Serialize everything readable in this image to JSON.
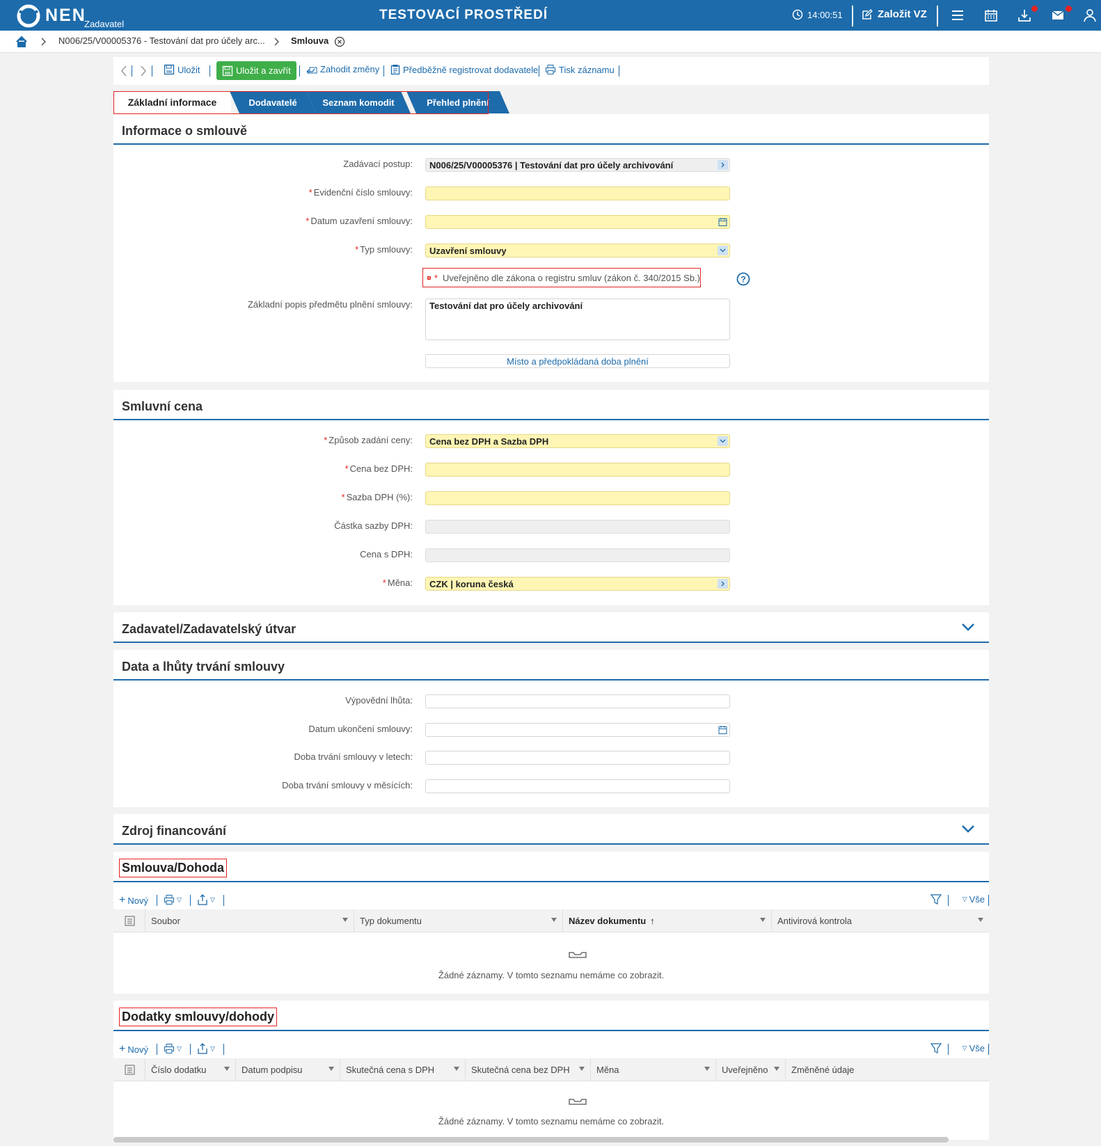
{
  "topbar": {
    "logo": "NEN",
    "logo_sub": "Zadavatel",
    "env_title": "TESTOVACÍ PROSTŘEDÍ",
    "time": "14:00:51",
    "new_tender": "Založit VZ",
    "icons": [
      "menu-icon",
      "calendar-icon",
      "download-icon",
      "mail-icon",
      "user-icon"
    ]
  },
  "breadcrumb": {
    "item1": "N006/25/V00005376 - Testování dat pro účely arc...",
    "item2": "Smlouva"
  },
  "toolbar": {
    "save": "Uložit",
    "save_close": "Uložit a zavřít",
    "discard": "Zahodit změny",
    "preregister": "Předběžně registrovat dodavatele",
    "print": "Tisk záznamu"
  },
  "tabs": [
    "Základní informace",
    "Dodavatelé",
    "Seznam komodit",
    "Přehled plnění"
  ],
  "contract_info": {
    "title": "Informace o smlouvě",
    "procedure_label": "Zadávací postup:",
    "procedure_value": "N006/25/V00005376 | Testování dat pro účely archivování",
    "number_label": "Evidenční číslo smlouvy:",
    "number_value": "",
    "date_label": "Datum uzavření smlouvy:",
    "date_value": "",
    "type_label": "Typ smlouvy:",
    "type_value": "Uzavření smlouvy",
    "published_label": "Uveřejněno dle zákona o registru smluv (zákon č. 340/2015 Sb.)",
    "description_label": "Základní popis předmětu plnění smlouvy:",
    "description_value": "Testování dat pro účely archivování",
    "place_button": "Místo a předpokládaná doba plnění"
  },
  "price": {
    "title": "Smluvní cena",
    "method_label": "Způsob zadání ceny:",
    "method_value": "Cena bez DPH a Sazba DPH",
    "net_label": "Cena bez DPH:",
    "vat_rate_label": "Sazba DPH (%):",
    "vat_amount_label": "Částka sazby DPH:",
    "gross_label": "Cena s DPH:",
    "currency_label": "Měna:",
    "currency_value": "CZK | koruna česká"
  },
  "authority": {
    "title": "Zadavatel/Zadavatelský útvar"
  },
  "dates": {
    "title": "Data a lhůty trvání smlouvy",
    "notice_label": "Výpovědní lhůta:",
    "end_label": "Datum ukončení smlouvy:",
    "years_label": "Doba trvání smlouvy v letech:",
    "months_label": "Doba trvání smlouvy v měsících:"
  },
  "funding": {
    "title": "Zdroj financování"
  },
  "contract_docs": {
    "title": "Smlouva/Dohoda",
    "new": "Nový",
    "all": "Vše",
    "columns": [
      "Soubor",
      "Typ dokumentu",
      "Název dokumentu",
      "Antivirová kontrola"
    ],
    "empty": "Žádné záznamy. V tomto seznamu nemáme co zobrazit."
  },
  "amendments": {
    "title": "Dodatky smlouvy/dohody",
    "new": "Nový",
    "all": "Vše",
    "columns": [
      "Číslo dodatku",
      "Datum podpisu",
      "Skutečná cena s DPH",
      "Skutečná cena bez DPH",
      "Měna",
      "Uveřejněno",
      "Změněné údaje"
    ],
    "empty": "Žádné záznamy. V tomto seznamu nemáme co zobrazit."
  },
  "colors": {
    "primary": "#1d6bab",
    "accent_green": "#3fae49",
    "required": "#e52321",
    "required_field": "#fff6b5"
  }
}
